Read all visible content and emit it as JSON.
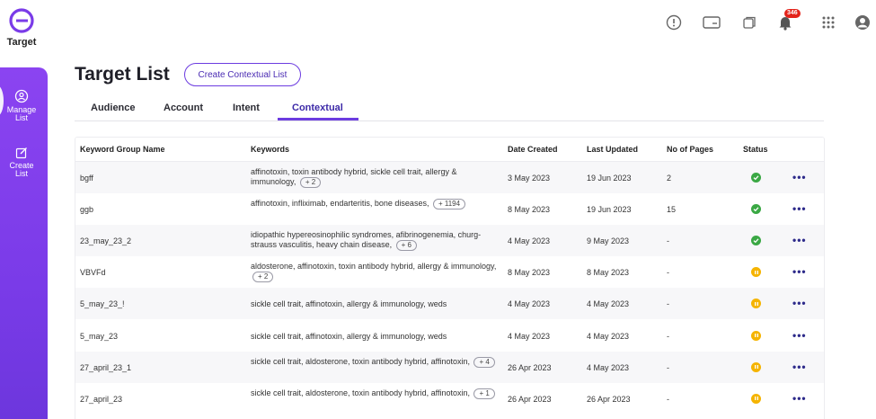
{
  "app": {
    "name": "Target"
  },
  "header": {
    "notification_count": "346"
  },
  "sidebar": {
    "items": [
      {
        "label_line1": "Manage",
        "label_line2": "List"
      },
      {
        "label_line1": "Create",
        "label_line2": "List"
      }
    ]
  },
  "page": {
    "title": "Target List",
    "create_button": "Create Contextual List"
  },
  "tabs": [
    "Audience",
    "Account",
    "Intent",
    "Contextual"
  ],
  "table": {
    "headers": [
      "Keyword Group Name",
      "Keywords",
      "Date Created",
      "Last Updated",
      "No of Pages",
      "Status"
    ],
    "rows": [
      {
        "name": "bgff",
        "keywords": "affinotoxin, toxin antibody hybrid, sickle cell trait, allergy & immunology,",
        "more": "+ 2",
        "created": "3 May 2023",
        "updated": "19 Jun 2023",
        "pages": "2",
        "status": "ok"
      },
      {
        "name": "ggb",
        "keywords": "affinotoxin, infliximab, endarteritis, bone diseases,",
        "more": "+ 1194",
        "created": "8 May 2023",
        "updated": "19 Jun 2023",
        "pages": "15",
        "status": "ok"
      },
      {
        "name": "23_may_23_2",
        "keywords": "idiopathic hypereosinophilic syndromes, afibrinogenemia, churg-strauss vasculitis, heavy chain disease,",
        "more": "+ 6",
        "created": "4 May 2023",
        "updated": "9 May 2023",
        "pages": "-",
        "status": "ok"
      },
      {
        "name": "VBVFd",
        "keywords": "aldosterone, affinotoxin, toxin antibody hybrid, allergy & immunology,",
        "more": "+ 2",
        "created": "8 May 2023",
        "updated": "8 May 2023",
        "pages": "-",
        "status": "pending"
      },
      {
        "name": "5_may_23_!",
        "keywords": "sickle cell trait, affinotoxin, allergy & immunology, weds",
        "more": "",
        "created": "4 May 2023",
        "updated": "4 May 2023",
        "pages": "-",
        "status": "pending"
      },
      {
        "name": "5_may_23",
        "keywords": "sickle cell trait, affinotoxin, allergy & immunology, weds",
        "more": "",
        "created": "4 May 2023",
        "updated": "4 May 2023",
        "pages": "-",
        "status": "pending"
      },
      {
        "name": "27_april_23_1",
        "keywords": "sickle cell trait, aldosterone, toxin antibody hybrid, affinotoxin,",
        "more": "+ 4",
        "created": "26 Apr 2023",
        "updated": "4 May 2023",
        "pages": "-",
        "status": "pending"
      },
      {
        "name": "27_april_23",
        "keywords": "sickle cell trait, aldosterone, toxin antibody hybrid, affinotoxin,",
        "more": "+ 1",
        "created": "26 Apr 2023",
        "updated": "26 Apr 2023",
        "pages": "-",
        "status": "pending"
      }
    ],
    "more_label": "•••"
  },
  "colors": {
    "accent": "#6c3ce0",
    "status_ok": "#3aa844",
    "status_pending": "#f5b400",
    "badge": "#e3231a"
  },
  "icons": [
    "info-icon",
    "card-icon",
    "copy-icon",
    "bell-icon",
    "apps-grid-icon",
    "user-avatar-icon",
    "manage-list-icon",
    "create-list-icon"
  ]
}
